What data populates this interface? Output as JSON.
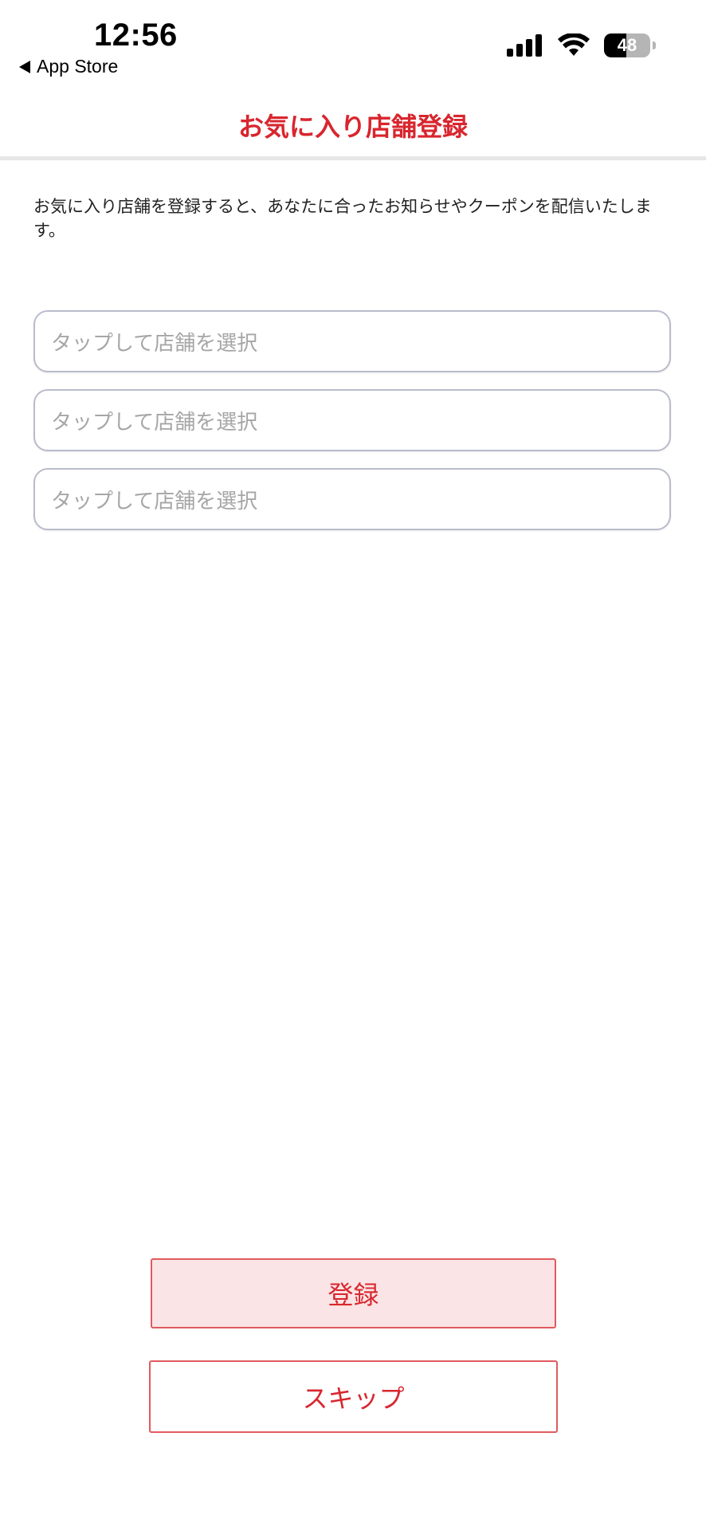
{
  "status_bar": {
    "time": "12:56",
    "back_label": "App Store",
    "battery_percent": 48,
    "battery_label": "48"
  },
  "header": {
    "title": "お気に入り店舗登録"
  },
  "main": {
    "description": "お気に入り店舗を登録すると、あなたに合ったお知らせやクーポンを配信いたします。",
    "store_fields": [
      {
        "placeholder": "タップして店舗を選択"
      },
      {
        "placeholder": "タップして店舗を選択"
      },
      {
        "placeholder": "タップして店舗を選択"
      }
    ]
  },
  "actions": {
    "register_label": "登録",
    "skip_label": "スキップ"
  },
  "colors": {
    "accent": "#d8262e",
    "register_bg": "#fbe4e5",
    "field_border": "#b9bccb",
    "placeholder": "#a6a6a6"
  },
  "icons": [
    "back-arrow-icon",
    "cellular-signal-icon",
    "wifi-icon",
    "battery-icon"
  ]
}
